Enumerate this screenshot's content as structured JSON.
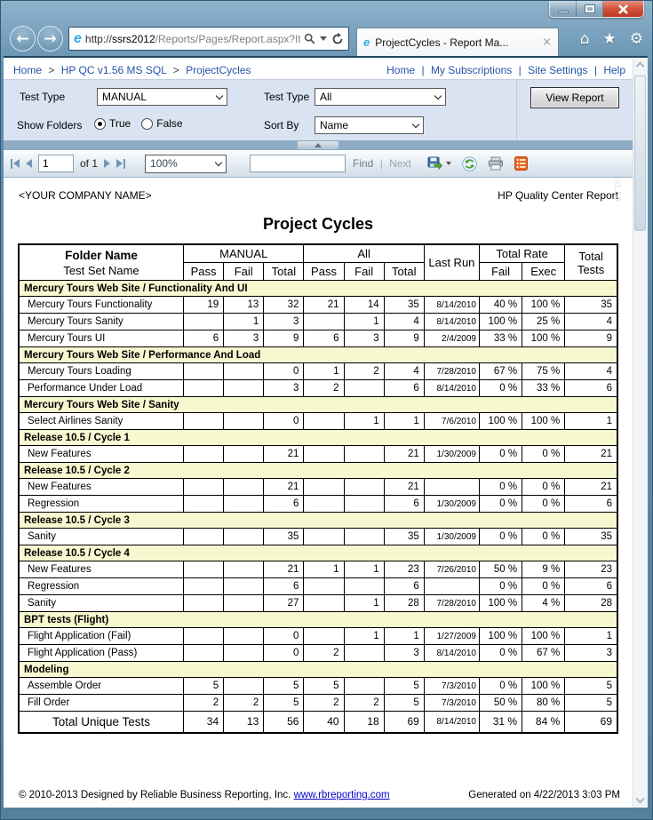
{
  "browser": {
    "url_scheme": "http://",
    "url_host": "ssrs2012",
    "url_path": "/Reports/Pages/Report.aspx?Item",
    "tab_title": "ProjectCycles - Report Ma...",
    "icons": {
      "back": "←",
      "forward": "→",
      "home": "⌂",
      "star": "★",
      "gear": "⚙",
      "tab_close": "×"
    }
  },
  "breadcrumb": {
    "items": [
      "Home",
      "HP QC v1.56 MS SQL",
      "ProjectCycles"
    ],
    "separator": ">"
  },
  "toplinks": {
    "items": [
      "Home",
      "My Subscriptions",
      "Site Settings",
      "Help"
    ],
    "separator": "|"
  },
  "params": {
    "test_type_label": "Test Type",
    "test_type_value": "MANUAL",
    "test_type2_label": "Test Type",
    "test_type2_value": "All",
    "show_folders_label": "Show Folders",
    "true_label": "True",
    "false_label": "False",
    "sort_by_label": "Sort By",
    "sort_by_value": "Name",
    "view_report_label": "View Report"
  },
  "toolbar": {
    "page_value": "1",
    "of_label": "of 1",
    "zoom_value": "100%",
    "find_value": "",
    "find_label": "Find",
    "next_label": "Next"
  },
  "report": {
    "company": "<YOUR COMPANY NAME>",
    "product": "HP Quality Center Report",
    "title": "Project Cycles",
    "watermark": "v1.56"
  },
  "table": {
    "headers": {
      "folder": "Folder Name",
      "testset": "Test Set Name",
      "manual": "MANUAL",
      "all": "All",
      "pass": "Pass",
      "fail": "Fail",
      "total": "Total",
      "last_run": "Last Run",
      "total_rate": "Total Rate",
      "exec": "Exec",
      "total_tests": "Total Tests"
    },
    "groups": [
      {
        "name": "Mercury Tours Web Site / Functionality And UI",
        "rows": [
          {
            "name": "Mercury Tours Functionality",
            "cells": [
              "19",
              "13",
              "32",
              "21",
              "14",
              "35",
              "8/14/2010",
              "40 %",
              "100 %",
              "35"
            ]
          },
          {
            "name": "Mercury Tours Sanity",
            "cells": [
              "",
              "1",
              "3",
              "",
              "1",
              "4",
              "8/14/2010",
              "100 %",
              "25 %",
              "4"
            ]
          },
          {
            "name": "Mercury Tours UI",
            "cells": [
              "6",
              "3",
              "9",
              "6",
              "3",
              "9",
              "2/4/2009",
              "33 %",
              "100 %",
              "9"
            ]
          }
        ]
      },
      {
        "name": "Mercury Tours Web Site / Performance And Load",
        "rows": [
          {
            "name": "Mercury Tours Loading",
            "cells": [
              "",
              "",
              "0",
              "1",
              "2",
              "4",
              "7/28/2010",
              "67 %",
              "75 %",
              "4"
            ]
          },
          {
            "name": "Performance Under Load",
            "cells": [
              "",
              "",
              "3",
              "2",
              "",
              "6",
              "8/14/2010",
              "0 %",
              "33 %",
              "6"
            ]
          }
        ]
      },
      {
        "name": "Mercury Tours Web Site / Sanity",
        "rows": [
          {
            "name": "Select Airlines Sanity",
            "cells": [
              "",
              "",
              "0",
              "",
              "1",
              "1",
              "7/6/2010",
              "100 %",
              "100 %",
              "1"
            ]
          }
        ]
      },
      {
        "name": "Release 10.5 / Cycle 1",
        "rows": [
          {
            "name": "New Features",
            "cells": [
              "",
              "",
              "21",
              "",
              "",
              "21",
              "1/30/2009",
              "0 %",
              "0 %",
              "21"
            ]
          }
        ]
      },
      {
        "name": "Release 10.5 / Cycle 2",
        "rows": [
          {
            "name": "New Features",
            "cells": [
              "",
              "",
              "21",
              "",
              "",
              "21",
              "",
              "0 %",
              "0 %",
              "21"
            ]
          },
          {
            "name": "Regression",
            "cells": [
              "",
              "",
              "6",
              "",
              "",
              "6",
              "1/30/2009",
              "0 %",
              "0 %",
              "6"
            ]
          }
        ]
      },
      {
        "name": "Release 10.5 / Cycle 3",
        "rows": [
          {
            "name": "Sanity",
            "cells": [
              "",
              "",
              "35",
              "",
              "",
              "35",
              "1/30/2009",
              "0 %",
              "0 %",
              "35"
            ]
          }
        ]
      },
      {
        "name": "Release 10.5 / Cycle 4",
        "rows": [
          {
            "name": "New Features",
            "cells": [
              "",
              "",
              "21",
              "1",
              "1",
              "23",
              "7/26/2010",
              "50 %",
              "9 %",
              "23"
            ]
          },
          {
            "name": "Regression",
            "cells": [
              "",
              "",
              "6",
              "",
              "",
              "6",
              "",
              "0 %",
              "0 %",
              "6"
            ]
          },
          {
            "name": "Sanity",
            "cells": [
              "",
              "",
              "27",
              "",
              "1",
              "28",
              "7/28/2010",
              "100 %",
              "4 %",
              "28"
            ]
          }
        ]
      },
      {
        "name": "BPT tests (Flight)",
        "rows": [
          {
            "name": "Flight Application (Fail)",
            "cells": [
              "",
              "",
              "0",
              "",
              "1",
              "1",
              "1/27/2009",
              "100 %",
              "100 %",
              "1"
            ]
          },
          {
            "name": "Flight Application (Pass)",
            "cells": [
              "",
              "",
              "0",
              "2",
              "",
              "3",
              "8/14/2010",
              "0 %",
              "67 %",
              "3"
            ]
          }
        ]
      },
      {
        "name": "Modeling",
        "rows": [
          {
            "name": "Assemble Order",
            "cells": [
              "5",
              "",
              "5",
              "5",
              "",
              "5",
              "7/3/2010",
              "0 %",
              "100 %",
              "5"
            ]
          },
          {
            "name": "Fill Order",
            "cells": [
              "2",
              "2",
              "5",
              "2",
              "2",
              "5",
              "7/3/2010",
              "50 %",
              "80 %",
              "5"
            ]
          }
        ]
      }
    ],
    "total": {
      "name": "Total Unique Tests",
      "cells": [
        "34",
        "13",
        "56",
        "40",
        "18",
        "69",
        "8/14/2010",
        "31 %",
        "84 %",
        "69"
      ]
    }
  },
  "footer": {
    "copyright": "© 2010-2013 Designed by Reliable Business Reporting, Inc.",
    "link": "www.rbreporting.com",
    "generated": "Generated on 4/22/2013 3:03 PM"
  }
}
